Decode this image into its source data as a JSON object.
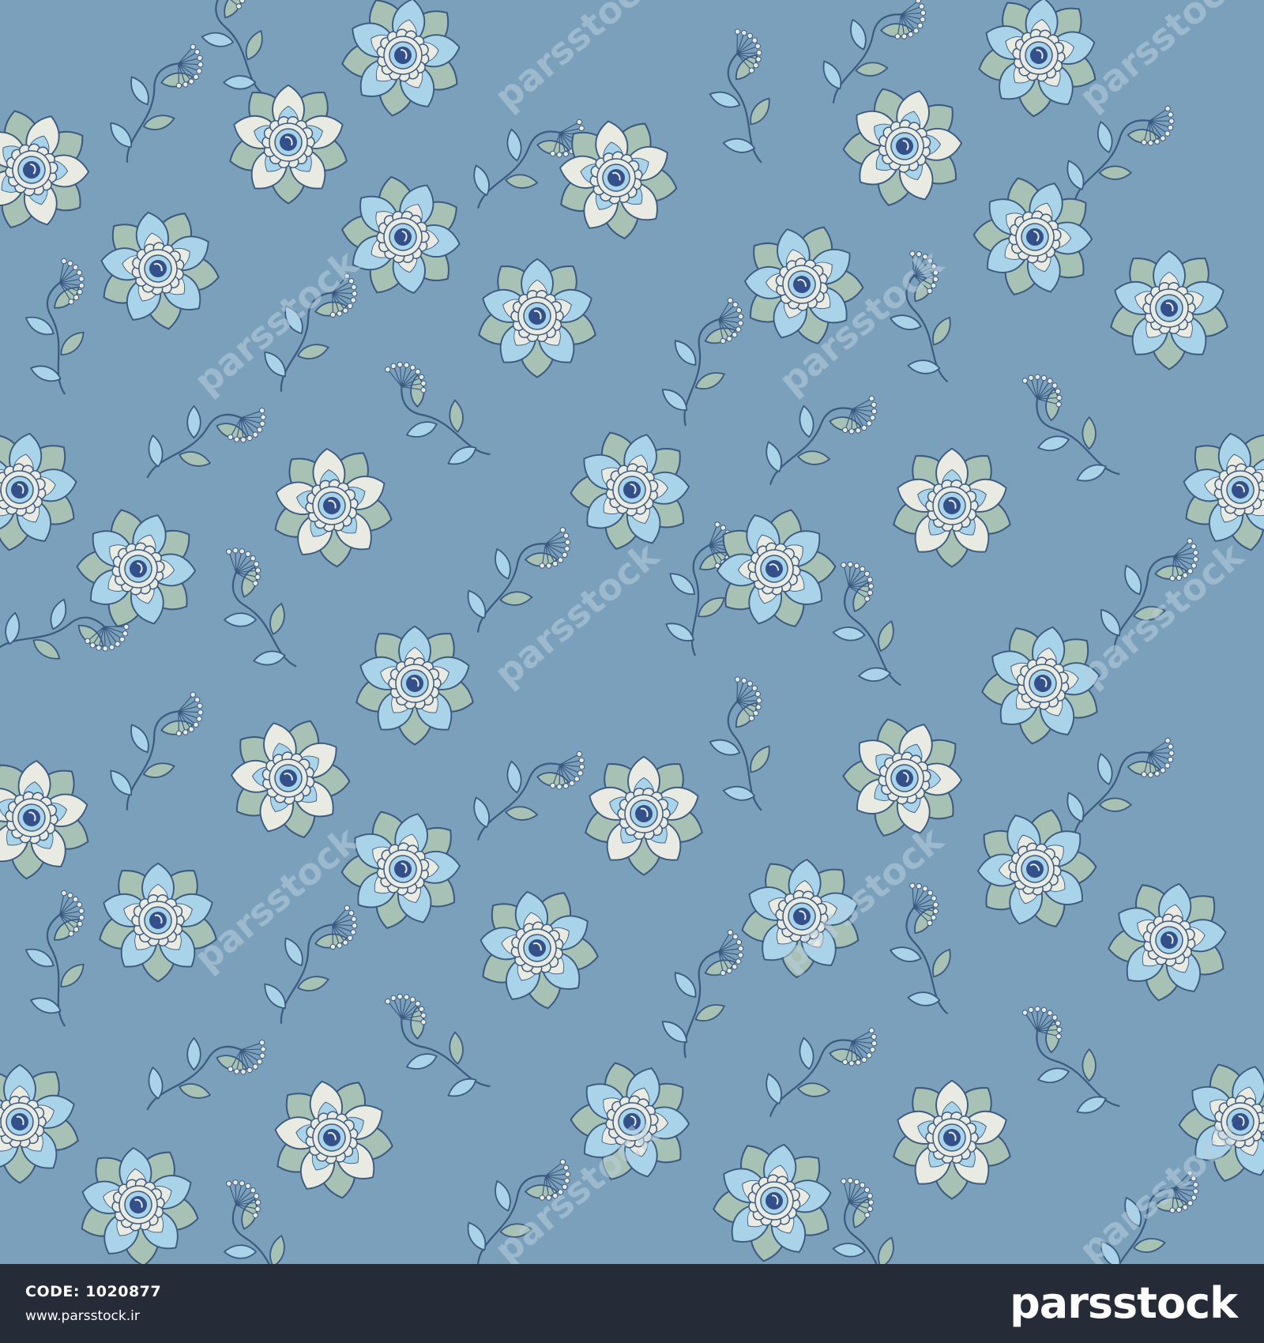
{
  "pattern": {
    "background_color": "#7aa0bb",
    "outline_color": "#3c5a80",
    "petal_light_blue": "#a9d3e8",
    "petal_cream": "#e9ebe2",
    "leaf_sage": "#a7c1b4",
    "center_navy": "#33508a",
    "watermark_color": "#b8cfdf",
    "watermark_text": "parsstock",
    "motifs": [
      "flower-icon",
      "berry-sprig-icon",
      "leaf-icon"
    ]
  },
  "footer": {
    "background_color": "#252c38",
    "code_label": "CODE:",
    "code_value": "1020877",
    "website": "www.parsstock.ir",
    "brand": "parsstock"
  }
}
